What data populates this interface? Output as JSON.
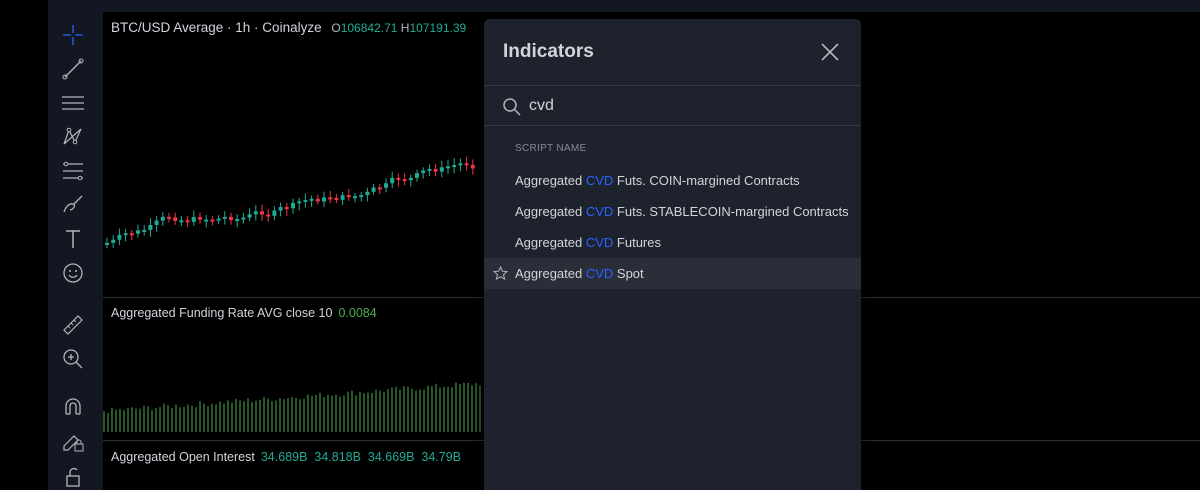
{
  "chart": {
    "symbol_title": "BTC/USD Average · 1h · Coinalyze",
    "o_label": "O",
    "o_value": "106842.71",
    "h_label": "H",
    "h_value": "107191.39"
  },
  "panes": [
    {
      "label": "Aggregated Funding Rate AVG close 10",
      "values": "0.0084"
    },
    {
      "label": "Aggregated Open Interest",
      "values": "34.689B  34.818B  34.669B  34.79B"
    }
  ],
  "toolbar": {
    "tools": [
      "crosshair-icon",
      "trend-line-icon",
      "horizontal-lines-icon",
      "pattern-icon",
      "fib-icon",
      "brush-icon",
      "text-icon",
      "emoji-icon",
      "ruler-icon",
      "zoom-in-icon",
      "magnet-icon",
      "lock-draw-icon",
      "unlock-icon"
    ]
  },
  "dialog": {
    "title": "Indicators",
    "search": {
      "value": "cvd",
      "placeholder": "Search"
    },
    "section_header": "SCRIPT NAME",
    "results": [
      {
        "prefix": "Aggregated ",
        "match": "CVD",
        "suffix": " Futs. COIN-margined Contracts",
        "hovered": false
      },
      {
        "prefix": "Aggregated ",
        "match": "CVD",
        "suffix": " Futs. STABLECOIN-margined Contracts",
        "hovered": false
      },
      {
        "prefix": "Aggregated ",
        "match": "CVD",
        "suffix": " Futures",
        "hovered": false
      },
      {
        "prefix": "Aggregated ",
        "match": "CVD",
        "suffix": " Spot",
        "hovered": true
      }
    ]
  },
  "colors": {
    "up": "#22ab94",
    "down": "#f23645",
    "match_highlight": "#2962ff",
    "funding_bar": "#4caf50"
  }
}
